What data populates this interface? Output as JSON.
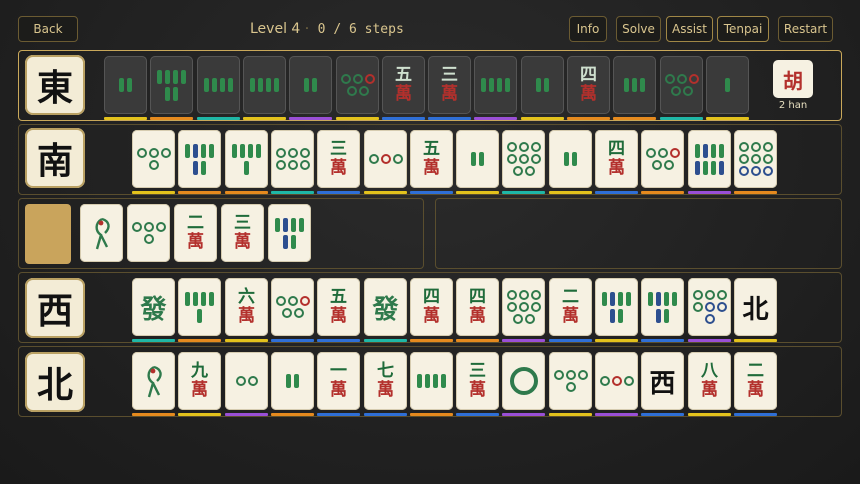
{
  "toolbar": {
    "back": "Back",
    "info": "Info",
    "solve": "Solve",
    "assist": "Assist",
    "tenpai": "Tenpai",
    "restart": "Restart"
  },
  "status": {
    "level": "Level 4",
    "sep": "·",
    "steps": "0 / 6 steps"
  },
  "result": {
    "glyph": "胡",
    "han": "2 han"
  },
  "colors": {
    "orange": "#e58a1e",
    "blue": "#2f6fd6",
    "purple": "#9a4fd6",
    "teal": "#1fb7a6",
    "yellow": "#e3c21c"
  },
  "rows": [
    {
      "wind": "東",
      "tiles": [
        {
          "k": "bam",
          "n": 2,
          "dim": true,
          "bar": "yellow"
        },
        {
          "k": "bam",
          "n": 6,
          "dim": true,
          "bar": "orange"
        },
        {
          "k": "bam",
          "n": 4,
          "dim": true,
          "bar": "teal"
        },
        {
          "k": "bam",
          "n": 4,
          "dim": true,
          "bar": "yellow"
        },
        {
          "k": "bam",
          "n": 2,
          "dim": true,
          "bar": "purple"
        },
        {
          "k": "dot",
          "n": 5,
          "dim": true,
          "bar": "yellow"
        },
        {
          "k": "man",
          "c": "五",
          "c2": "萬",
          "dim": true,
          "bar": "blue"
        },
        {
          "k": "man",
          "c": "三",
          "c2": "萬",
          "dim": true,
          "bar": "blue"
        },
        {
          "k": "bam",
          "n": 4,
          "dim": true,
          "bar": "purple"
        },
        {
          "k": "bam",
          "n": 2,
          "dim": true,
          "bar": "yellow"
        },
        {
          "k": "man",
          "c": "四",
          "c2": "萬",
          "dim": true,
          "bar": "orange"
        },
        {
          "k": "bam",
          "n": 3,
          "dim": true,
          "bar": "orange"
        },
        {
          "k": "dot",
          "n": 5,
          "dim": true,
          "bar": "teal"
        },
        {
          "k": "bam",
          "n": 1,
          "dim": true,
          "bar": "yellow"
        }
      ]
    },
    {
      "wind": "南",
      "tiles": [
        {
          "k": "dot",
          "n": 4,
          "bar": "yellow"
        },
        {
          "k": "bam",
          "n": 6,
          "bar": "orange"
        },
        {
          "k": "bam",
          "n": 5,
          "bar": "orange"
        },
        {
          "k": "dot",
          "n": 6,
          "bar": "teal"
        },
        {
          "k": "man",
          "c": "三",
          "c2": "萬",
          "bar": "blue"
        },
        {
          "k": "dot",
          "n": 3,
          "bar": "yellow"
        },
        {
          "k": "man",
          "c": "五",
          "c2": "萬",
          "bar": "blue"
        },
        {
          "k": "bam",
          "n": 2,
          "bar": "yellow"
        },
        {
          "k": "dot",
          "n": 8,
          "bar": "teal"
        },
        {
          "k": "bam",
          "n": 2,
          "bar": "yellow"
        },
        {
          "k": "man",
          "c": "四",
          "c2": "萬",
          "bar": "blue"
        },
        {
          "k": "dot",
          "n": 5,
          "bar": "orange"
        },
        {
          "k": "bam",
          "n": 8,
          "bar": "purple"
        },
        {
          "k": "dot",
          "n": 9,
          "bar": "orange"
        }
      ]
    },
    {
      "wind": "",
      "tiles": [
        {
          "k": "bird"
        },
        {
          "k": "dot",
          "n": 4
        },
        {
          "k": "man",
          "c": "二",
          "c2": "萬"
        },
        {
          "k": "man",
          "c": "三",
          "c2": "萬"
        },
        {
          "k": "bam",
          "n": 6
        }
      ]
    },
    {
      "wind": "西",
      "tiles": [
        {
          "k": "hon",
          "c": "發",
          "col": "#2f7a4c",
          "bar": "teal"
        },
        {
          "k": "bam",
          "n": 5,
          "bar": "orange"
        },
        {
          "k": "man",
          "c": "六",
          "c2": "萬",
          "bar": "yellow"
        },
        {
          "k": "dot",
          "n": 5,
          "bar": "blue"
        },
        {
          "k": "man",
          "c": "五",
          "c2": "萬",
          "bar": "blue"
        },
        {
          "k": "hon",
          "c": "發",
          "col": "#2f7a4c",
          "bar": "teal"
        },
        {
          "k": "man",
          "c": "四",
          "c2": "萬",
          "bar": "orange"
        },
        {
          "k": "man",
          "c": "四",
          "c2": "萬",
          "bar": "orange"
        },
        {
          "k": "dot",
          "n": 8,
          "bar": "purple"
        },
        {
          "k": "man",
          "c": "二",
          "c2": "萬",
          "bar": "blue"
        },
        {
          "k": "bam",
          "n": 6,
          "bar": "yellow"
        },
        {
          "k": "bam",
          "n": 6,
          "bar": "blue"
        },
        {
          "k": "dot",
          "n": 7,
          "bar": "purple"
        },
        {
          "k": "hon",
          "c": "北",
          "col": "#111",
          "bar": "yellow"
        }
      ]
    },
    {
      "wind": "北",
      "tiles": [
        {
          "k": "bird",
          "bar": "orange"
        },
        {
          "k": "man",
          "c": "九",
          "c2": "萬",
          "bar": "yellow"
        },
        {
          "k": "dot",
          "n": 2,
          "bar": "purple"
        },
        {
          "k": "bam",
          "n": 2,
          "bar": "orange"
        },
        {
          "k": "man",
          "c": "一",
          "c2": "萬",
          "bar": "blue"
        },
        {
          "k": "man",
          "c": "七",
          "c2": "萬",
          "bar": "blue"
        },
        {
          "k": "bam",
          "n": 4,
          "bar": "orange"
        },
        {
          "k": "man",
          "c": "三",
          "c2": "萬",
          "bar": "blue"
        },
        {
          "k": "dot",
          "n": 1,
          "bar": "purple"
        },
        {
          "k": "dot",
          "n": 4,
          "bar": "yellow"
        },
        {
          "k": "dot",
          "n": 3,
          "bar": "purple"
        },
        {
          "k": "hon",
          "c": "西",
          "col": "#111",
          "bar": "blue"
        },
        {
          "k": "man",
          "c": "八",
          "c2": "萬",
          "bar": "yellow"
        },
        {
          "k": "man",
          "c": "二",
          "c2": "萬",
          "bar": "blue"
        }
      ]
    }
  ]
}
